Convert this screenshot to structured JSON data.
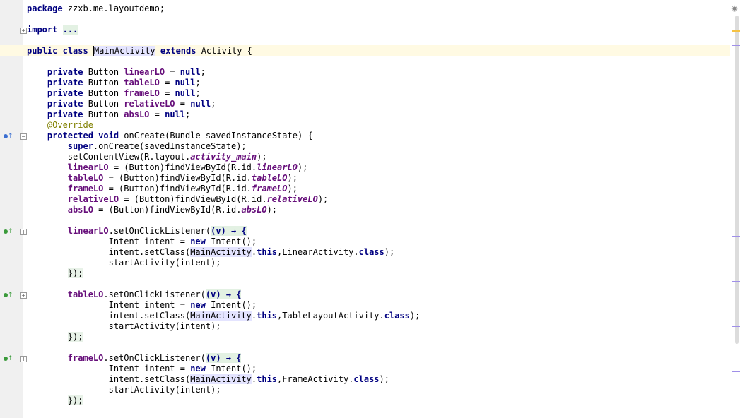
{
  "editor": {
    "language": "java",
    "colors": {
      "keyword": "#000080",
      "field": "#660e7a",
      "annotation": "#808000",
      "caret_line": "#fffae3",
      "identifier_highlight": "#e4e4ff",
      "gutter": "#f0f0f0",
      "marker_warning": "#f5c243",
      "marker_usage": "#9f8fe8"
    },
    "lines": [
      {
        "segs": [
          {
            "t": "package",
            "c": "kw"
          },
          {
            "t": " zzxb.me.layoutdemo;"
          }
        ]
      },
      {
        "segs": []
      },
      {
        "segs": [
          {
            "t": "import",
            "c": "kw"
          },
          {
            "t": " "
          },
          {
            "t": "...",
            "c": "fold-text"
          }
        ]
      },
      {
        "segs": []
      },
      {
        "segs": [
          {
            "t": "public",
            "c": "kw"
          },
          {
            "t": " "
          },
          {
            "t": "class",
            "c": "kw"
          },
          {
            "t": " "
          },
          {
            "t": "MainActivity",
            "c": "hl caret"
          },
          {
            "t": " "
          },
          {
            "t": "extends",
            "c": "kw"
          },
          {
            "t": " Activity {"
          }
        ]
      },
      {
        "segs": []
      },
      {
        "segs": [
          {
            "t": "    "
          },
          {
            "t": "private",
            "c": "kw"
          },
          {
            "t": " Button "
          },
          {
            "t": "linearLO",
            "c": "fld"
          },
          {
            "t": " = "
          },
          {
            "t": "null",
            "c": "kw"
          },
          {
            "t": ";"
          }
        ]
      },
      {
        "segs": [
          {
            "t": "    "
          },
          {
            "t": "private",
            "c": "kw"
          },
          {
            "t": " Button "
          },
          {
            "t": "tableLO",
            "c": "fld"
          },
          {
            "t": " = "
          },
          {
            "t": "null",
            "c": "kw"
          },
          {
            "t": ";"
          }
        ]
      },
      {
        "segs": [
          {
            "t": "    "
          },
          {
            "t": "private",
            "c": "kw"
          },
          {
            "t": " Button "
          },
          {
            "t": "frameLO",
            "c": "fld"
          },
          {
            "t": " = "
          },
          {
            "t": "null",
            "c": "kw"
          },
          {
            "t": ";"
          }
        ]
      },
      {
        "segs": [
          {
            "t": "    "
          },
          {
            "t": "private",
            "c": "kw"
          },
          {
            "t": " Button "
          },
          {
            "t": "relativeLO",
            "c": "fld"
          },
          {
            "t": " = "
          },
          {
            "t": "null",
            "c": "kw"
          },
          {
            "t": ";"
          }
        ]
      },
      {
        "segs": [
          {
            "t": "    "
          },
          {
            "t": "private",
            "c": "kw"
          },
          {
            "t": " Button "
          },
          {
            "t": "absLO",
            "c": "fld"
          },
          {
            "t": " = "
          },
          {
            "t": "null",
            "c": "kw"
          },
          {
            "t": ";"
          }
        ]
      },
      {
        "segs": [
          {
            "t": "    "
          },
          {
            "t": "@Override",
            "c": "ann"
          }
        ]
      },
      {
        "segs": [
          {
            "t": "    "
          },
          {
            "t": "protected",
            "c": "kw"
          },
          {
            "t": " "
          },
          {
            "t": "void",
            "c": "kw"
          },
          {
            "t": " onCreate(Bundle savedInstanceState) {"
          }
        ]
      },
      {
        "segs": [
          {
            "t": "        "
          },
          {
            "t": "super",
            "c": "kw"
          },
          {
            "t": ".onCreate(savedInstanceState);"
          }
        ]
      },
      {
        "segs": [
          {
            "t": "        setContentView(R.layout."
          },
          {
            "t": "activity_main",
            "c": "fldi"
          },
          {
            "t": ");"
          }
        ]
      },
      {
        "segs": [
          {
            "t": "        "
          },
          {
            "t": "linearLO",
            "c": "fld"
          },
          {
            "t": " = (Button)findViewById(R.id."
          },
          {
            "t": "linearLO",
            "c": "fldi"
          },
          {
            "t": ");"
          }
        ]
      },
      {
        "segs": [
          {
            "t": "        "
          },
          {
            "t": "tableLO",
            "c": "fld"
          },
          {
            "t": " = (Button)findViewById(R.id."
          },
          {
            "t": "tableLO",
            "c": "fldi"
          },
          {
            "t": ");"
          }
        ]
      },
      {
        "segs": [
          {
            "t": "        "
          },
          {
            "t": "frameLO",
            "c": "fld"
          },
          {
            "t": " = (Button)findViewById(R.id."
          },
          {
            "t": "frameLO",
            "c": "fldi"
          },
          {
            "t": ");"
          }
        ]
      },
      {
        "segs": [
          {
            "t": "        "
          },
          {
            "t": "relativeLO",
            "c": "fld"
          },
          {
            "t": " = (Button)findViewById(R.id."
          },
          {
            "t": "relativeLO",
            "c": "fldi"
          },
          {
            "t": ");"
          }
        ]
      },
      {
        "segs": [
          {
            "t": "        "
          },
          {
            "t": "absLO",
            "c": "fld"
          },
          {
            "t": " = (Button)findViewById(R.id."
          },
          {
            "t": "absLO",
            "c": "fldi"
          },
          {
            "t": ");"
          }
        ]
      },
      {
        "segs": []
      },
      {
        "segs": [
          {
            "t": "        "
          },
          {
            "t": "linearLO",
            "c": "fld"
          },
          {
            "t": ".setOnClickListener("
          },
          {
            "t": "(v) → {",
            "c": "fold-text"
          }
        ]
      },
      {
        "segs": [
          {
            "t": "                Intent intent = "
          },
          {
            "t": "new",
            "c": "kw"
          },
          {
            "t": " Intent();"
          }
        ]
      },
      {
        "segs": [
          {
            "t": "                intent.setClass("
          },
          {
            "t": "MainActivity",
            "c": "hl"
          },
          {
            "t": "."
          },
          {
            "t": "this",
            "c": "kw"
          },
          {
            "t": ",LinearActivity."
          },
          {
            "t": "class",
            "c": "kw"
          },
          {
            "t": ");"
          }
        ]
      },
      {
        "segs": [
          {
            "t": "                startActivity(intent);"
          }
        ]
      },
      {
        "segs": [
          {
            "t": "        "
          },
          {
            "t": "});",
            "c": "lambda-hl"
          }
        ]
      },
      {
        "segs": []
      },
      {
        "segs": [
          {
            "t": "        "
          },
          {
            "t": "tableLO",
            "c": "fld"
          },
          {
            "t": ".setOnClickListener("
          },
          {
            "t": "(v) → {",
            "c": "fold-text"
          }
        ]
      },
      {
        "segs": [
          {
            "t": "                Intent intent = "
          },
          {
            "t": "new",
            "c": "kw"
          },
          {
            "t": " Intent();"
          }
        ]
      },
      {
        "segs": [
          {
            "t": "                intent.setClass("
          },
          {
            "t": "MainActivity",
            "c": "hl"
          },
          {
            "t": "."
          },
          {
            "t": "this",
            "c": "kw"
          },
          {
            "t": ",TableLayoutActivity."
          },
          {
            "t": "class",
            "c": "kw"
          },
          {
            "t": ");"
          }
        ]
      },
      {
        "segs": [
          {
            "t": "                startActivity(intent);"
          }
        ]
      },
      {
        "segs": [
          {
            "t": "        "
          },
          {
            "t": "});",
            "c": "lambda-hl"
          }
        ]
      },
      {
        "segs": []
      },
      {
        "segs": [
          {
            "t": "        "
          },
          {
            "t": "frameLO",
            "c": "fld"
          },
          {
            "t": ".setOnClickListener("
          },
          {
            "t": "(v) → {",
            "c": "fold-text"
          }
        ]
      },
      {
        "segs": [
          {
            "t": "                Intent intent = "
          },
          {
            "t": "new",
            "c": "kw"
          },
          {
            "t": " Intent();"
          }
        ]
      },
      {
        "segs": [
          {
            "t": "                intent.setClass("
          },
          {
            "t": "MainActivity",
            "c": "hl"
          },
          {
            "t": "."
          },
          {
            "t": "this",
            "c": "kw"
          },
          {
            "t": ",FrameActivity."
          },
          {
            "t": "class",
            "c": "kw"
          },
          {
            "t": ");"
          }
        ]
      },
      {
        "segs": [
          {
            "t": "                startActivity(intent);"
          }
        ]
      },
      {
        "segs": [
          {
            "t": "        "
          },
          {
            "t": "});",
            "c": "lambda-hl"
          }
        ]
      }
    ],
    "gutter_icons": [
      {
        "line": 13,
        "name": "override-method-icon",
        "color": "#3b6fd1"
      },
      {
        "line": 22,
        "name": "implements-method-icon",
        "color": "#3a9a3a"
      },
      {
        "line": 28,
        "name": "implements-method-icon",
        "color": "#3a9a3a"
      },
      {
        "line": 34,
        "name": "implements-method-icon",
        "color": "#3a9a3a"
      }
    ],
    "fold_markers": [
      {
        "line": 3,
        "state": "collapsed"
      },
      {
        "line": 13,
        "state": "expanded"
      },
      {
        "line": 22,
        "state": "collapsed"
      },
      {
        "line": 28,
        "state": "collapsed"
      },
      {
        "line": 34,
        "state": "collapsed"
      }
    ],
    "scrollbar": {
      "eye_icon": "eye-icon",
      "markers": [
        {
          "name": "warning-marker",
          "color": "#f5c243"
        },
        {
          "name": "usage-marker",
          "color": "#9f8fe8"
        },
        {
          "name": "usage-marker",
          "color": "#9f8fe8"
        },
        {
          "name": "usage-marker",
          "color": "#9f8fe8"
        },
        {
          "name": "usage-marker",
          "color": "#9f8fe8"
        },
        {
          "name": "usage-marker",
          "color": "#9f8fe8"
        },
        {
          "name": "usage-marker",
          "color": "#9f8fe8"
        },
        {
          "name": "usage-marker",
          "color": "#9f8fe8"
        }
      ]
    }
  }
}
